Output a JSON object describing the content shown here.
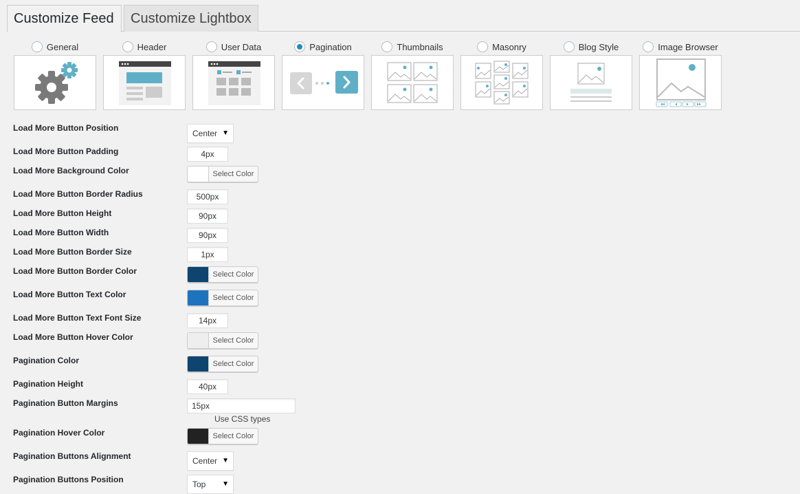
{
  "tabs": [
    {
      "label": "Customize Feed",
      "active": true
    },
    {
      "label": "Customize Lightbox",
      "active": false
    }
  ],
  "layouts": [
    {
      "label": "General",
      "checked": false,
      "icon": "gears-icon"
    },
    {
      "label": "Header",
      "checked": false,
      "icon": "header-layout-icon"
    },
    {
      "label": "User Data",
      "checked": false,
      "icon": "user-data-layout-icon"
    },
    {
      "label": "Pagination",
      "checked": true,
      "icon": "pagination-layout-icon"
    },
    {
      "label": "Thumbnails",
      "checked": false,
      "icon": "thumbnails-layout-icon"
    },
    {
      "label": "Masonry",
      "checked": false,
      "icon": "masonry-layout-icon"
    },
    {
      "label": "Blog Style",
      "checked": false,
      "icon": "blog-style-layout-icon"
    },
    {
      "label": "Image Browser",
      "checked": false,
      "icon": "image-browser-layout-icon"
    }
  ],
  "colors": {
    "accent_teal": "#5fb0c6",
    "radio_checked": "#1e8cbe",
    "gear_gray": "#777777"
  },
  "color_button_label": "Select Color",
  "settings": {
    "load_more_position": {
      "label": "Load More Button Position",
      "value": "Center"
    },
    "load_more_padding": {
      "label": "Load More Button Padding",
      "value": "4px"
    },
    "load_more_bg_color": {
      "label": "Load More Background Color",
      "color": "#ffffff"
    },
    "load_more_border_radius": {
      "label": "Load More Button Border Radius",
      "value": "500px"
    },
    "load_more_height": {
      "label": "Load More Button Height",
      "value": "90px"
    },
    "load_more_width": {
      "label": "Load More Button Width",
      "value": "90px"
    },
    "load_more_border_size": {
      "label": "Load More Button Border Size",
      "value": "1px"
    },
    "load_more_border_color": {
      "label": "Load More Button Border Color",
      "color": "#0e4470"
    },
    "load_more_text_color": {
      "label": "Load More Button Text Color",
      "color": "#1e73be"
    },
    "load_more_font_size": {
      "label": "Load More Button Text Font Size",
      "value": "14px"
    },
    "load_more_hover_color": {
      "label": "Load More Button Hover Color",
      "color": "#eeeeee"
    },
    "pagination_color": {
      "label": "Pagination Color",
      "color": "#0e4470"
    },
    "pagination_height": {
      "label": "Pagination Height",
      "value": "40px"
    },
    "pagination_margins": {
      "label": "Pagination Button Margins",
      "value": "15px",
      "hint": "Use CSS types"
    },
    "pagination_hover_color": {
      "label": "Pagination Hover Color",
      "color": "#222222"
    },
    "pagination_alignment": {
      "label": "Pagination Buttons Alignment",
      "value": "Center"
    },
    "pagination_position": {
      "label": "Pagination Buttons Position",
      "value": "Top"
    }
  }
}
